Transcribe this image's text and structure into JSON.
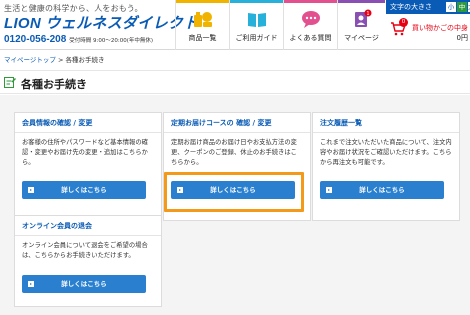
{
  "header": {
    "tagline": "生活と健康の科学から、人をおもう。",
    "brand": "LION ウェルネスダイレクト",
    "tel": "0120-056-208",
    "hours": "受付時間 9:00～20:00(年中無休)",
    "nav": [
      {
        "label": "商品一覧",
        "icon": "products-icon"
      },
      {
        "label": "ご利用ガイド",
        "icon": "guide-book-icon"
      },
      {
        "label": "よくある質問",
        "icon": "faq-chat-icon"
      },
      {
        "label": "マイページ",
        "icon": "mypage-icon"
      }
    ],
    "font_size_label": "文字の大きさ",
    "font_sizes": [
      "小",
      "中",
      "大"
    ],
    "cart_label": "買い物かごの中身",
    "cart_count": "0",
    "cart_amount": "0円"
  },
  "breadcrumb": {
    "home": "マイページトップ",
    "separator": " > ",
    "current": "各種お手続き"
  },
  "page_title": "各種お手続き",
  "cards": [
    {
      "title": "会員情報の確認 / 変更",
      "text": "お客様の住所やパスワードなど基本情報の確認・変更やお届け先の変更・追加はこちらから。",
      "button": "詳しくはこちら"
    },
    {
      "title": "定期お届けコースの 確認 / 変更",
      "text": "定期お届け商品のお届け日やお支払方法の変更、クーポンのご登録、休止のお手続きはこちらから。",
      "button": "詳しくはこちら"
    },
    {
      "title": "注文履歴一覧",
      "text": "これまで注文いただいた商品について、注文内容やお届け状況をご確認いただけます。こちらから再注文も可能です。",
      "button": "詳しくはこちら"
    },
    {
      "title": "オンライン会員の退会",
      "text": "オンライン会員について退会をご希望の場合は、こちらからお手続きいただけます。",
      "button": "詳しくはこちら"
    }
  ],
  "colors": {
    "brand_blue": "#0a5bb5",
    "button_blue": "#2a80cf",
    "highlight_orange": "#f39a1a",
    "cart_red": "#e60012"
  }
}
